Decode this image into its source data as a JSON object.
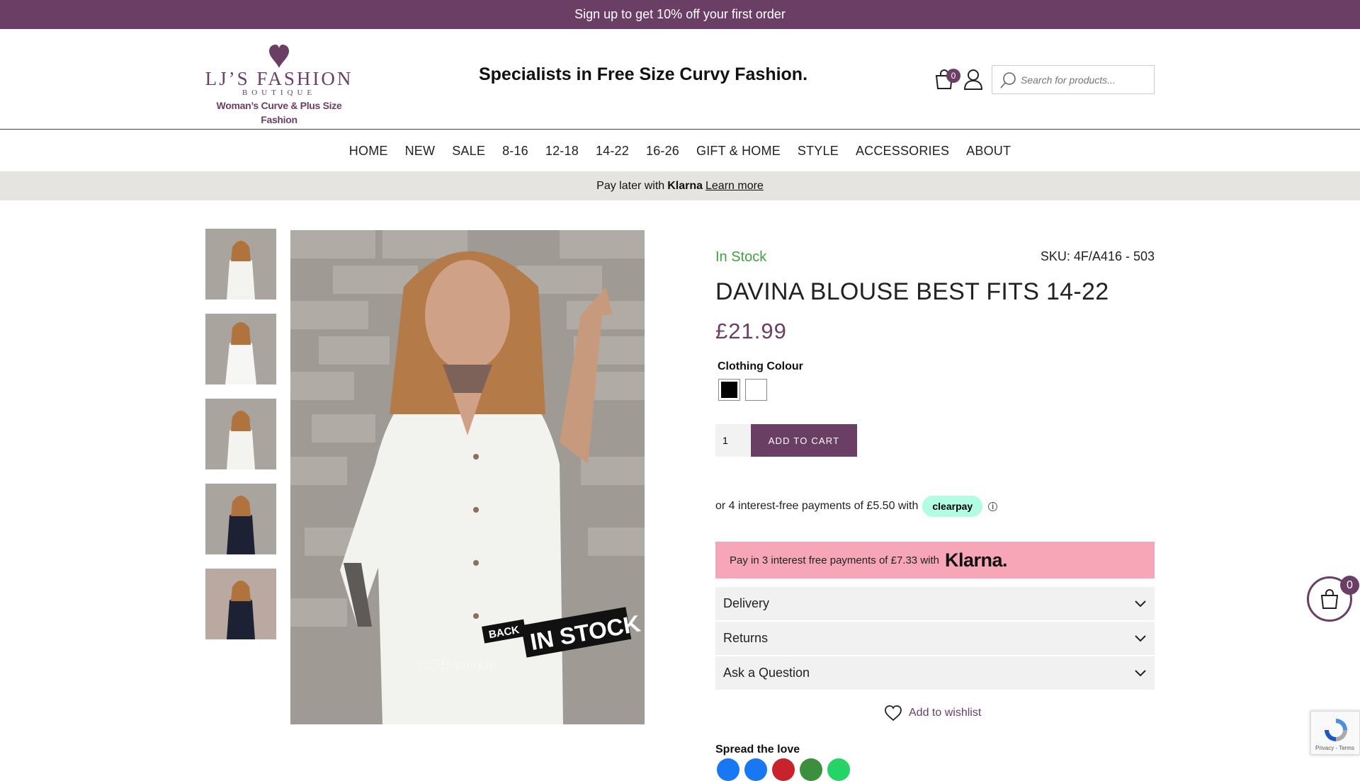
{
  "promo_bar": {
    "text": "Sign up to get 10% off your first order"
  },
  "header": {
    "logo": {
      "name": "LJ’S FASHION",
      "sub": "BOUTIQUE",
      "tagline": "Woman’s Curve & Plus Size Fashion"
    },
    "tagline": "Specialists in Free Size Curvy Fashion.",
    "cart_count": "0",
    "search_placeholder": "Search for products..."
  },
  "nav": {
    "items": [
      "HOME",
      "NEW",
      "SALE",
      "8-16",
      "12-18",
      "14-22",
      "16-26",
      "GIFT & HOME",
      "STYLE",
      "ACCESSORIES",
      "ABOUT"
    ]
  },
  "klarna_bar": {
    "prefix": "Pay later with",
    "brand": "Klarna",
    "link": "Learn more"
  },
  "product": {
    "stock_status": "In Stock",
    "sku": "SKU: 4F/A416 - 503",
    "title": "DAVINA BLOUSE BEST FITS 14-22",
    "price": "£21.99",
    "colour_label": "Clothing Colour",
    "colours": [
      "#000000",
      "#ffffff"
    ],
    "quantity": "1",
    "add_to_cart": "ADD TO CART",
    "image_watermark": "LJSBoutique",
    "image_badge_small": "BACK",
    "image_badge_big": "IN STOCK"
  },
  "clearpay": {
    "text": "or 4 interest-free payments of £5.50 with",
    "badge": "clearpay",
    "info": "i"
  },
  "klarna_box": {
    "text": "Pay in 3 interest free payments of £7.33 with",
    "brand": "Klarna."
  },
  "accordions": [
    "Delivery",
    "Returns",
    "Ask a Question"
  ],
  "wishlist": "Add to wishlist",
  "share": {
    "label": "Spread the love",
    "colors": [
      "#1877f2",
      "#1877f2",
      "#c8232c",
      "#3c8f3c",
      "#25d366"
    ]
  },
  "floating_cart": {
    "count": "0"
  },
  "recaptcha": {
    "links": "Privacy - Terms"
  },
  "colors": {
    "brand": "#6b3e66",
    "stock": "#3ea33e",
    "klarna_pink": "#f6a6b7",
    "clearpay_mint": "#b2fce4"
  }
}
